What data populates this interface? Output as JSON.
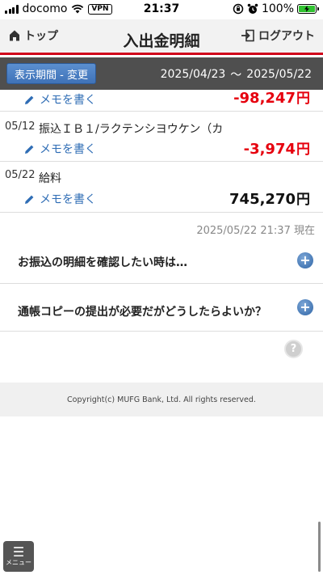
{
  "status_bar": {
    "carrier": "docomo",
    "vpn": "VPN",
    "time": "21:37",
    "battery": "100%"
  },
  "header": {
    "back_label": "トップ",
    "title": "入出金明細",
    "logout_label": "ログアウト"
  },
  "period": {
    "button_label": "表示期間 - 変更",
    "start": "2025/04/23",
    "separator": "～",
    "end": "2025/05/22"
  },
  "transactions": [
    {
      "date": "",
      "description": "",
      "memo_label": "メモを書く",
      "amount": "-98,247",
      "yen": "円"
    },
    {
      "date": "05/12",
      "description": "振込ＩＢ１/ラクテンシヨウケン（カ",
      "memo_label": "メモを書く",
      "amount": "-3,974",
      "yen": "円"
    },
    {
      "date": "05/22",
      "description": "給料",
      "memo_label": "メモを書く",
      "amount": "745,270",
      "yen": "円"
    }
  ],
  "timestamp": "2025/05/22 21:37 現在",
  "faq": [
    {
      "label": "お振込の明細を確認したい時は…"
    },
    {
      "label": "通帳コピーの提出が必要だがどうしたらよいか？"
    }
  ],
  "help_symbol": "?",
  "footer": {
    "copyright": "Copyright(c) MUFG Bank, Ltd. All rights reserved."
  },
  "menu": {
    "label": "メニュー"
  },
  "colors": {
    "accent_red": "#e6000e",
    "link_blue": "#2f6db5",
    "header_rule": "#d0021b"
  }
}
